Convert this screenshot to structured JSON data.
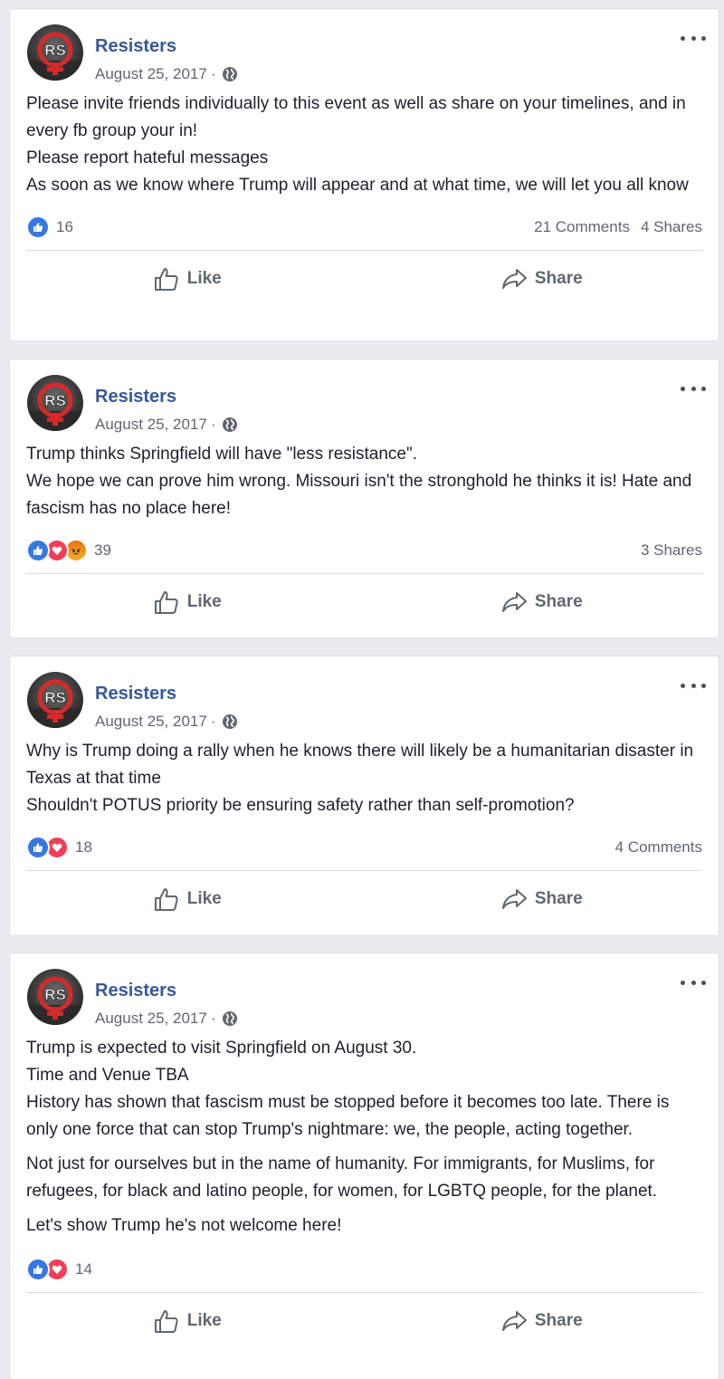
{
  "posts": [
    {
      "page_name": "Resisters",
      "date": "August 25, 2017",
      "paragraphs": [
        "Please invite friends individually to this event as well as share on your timelines, and in every fb group your in!",
        "Please report hateful messages",
        "As soon as we know where Trump will appear and at what time, we will let you all know"
      ],
      "reactions": [
        "like"
      ],
      "reaction_count": "16",
      "comments": "21 Comments",
      "shares": "4 Shares",
      "like_label": "Like",
      "share_label": "Share"
    },
    {
      "page_name": "Resisters",
      "date": "August 25, 2017",
      "paragraphs": [
        "Trump thinks Springfield will have \"less resistance\".",
        "We hope we can prove him wrong. Missouri isn't the stronghold he thinks it is! Hate and fascism has no place here!"
      ],
      "reactions": [
        "like",
        "love",
        "angry"
      ],
      "reaction_count": "39",
      "comments": "",
      "shares": "3 Shares",
      "like_label": "Like",
      "share_label": "Share"
    },
    {
      "page_name": "Resisters",
      "date": "August 25, 2017",
      "paragraphs": [
        "Why is Trump doing a rally when he knows there will likely be a humanitarian disaster in Texas at that time",
        "Shouldn't POTUS priority be ensuring safety rather than self-promotion?"
      ],
      "reactions": [
        "like",
        "love"
      ],
      "reaction_count": "18",
      "comments": "4 Comments",
      "shares": "",
      "like_label": "Like",
      "share_label": "Share"
    },
    {
      "page_name": "Resisters",
      "date": "August 25, 2017",
      "paragraphs": [
        "Trump is expected to visit Springfield on August 30.",
        "Time and Venue TBA",
        "History has shown that fascism must be stopped before it becomes too late. There is only one force that can stop Trump's nightmare: we, the people, acting together.",
        "Not just for ourselves but in the name of humanity. For immigrants, for Muslims, for refugees, for black and latino people, for women, for LGBTQ people, for the planet.",
        "Let's show Trump he's not welcome here!"
      ],
      "reactions": [
        "like",
        "love"
      ],
      "reaction_count": "14",
      "comments": "",
      "shares": "",
      "like_label": "Like",
      "share_label": "Share"
    }
  ],
  "avatar_text": "RS",
  "colors": {
    "page_name": "#365899",
    "like": "#3578e5",
    "love": "#f33e58",
    "angry": "#f7b125",
    "avatar_red": "#d42a2a"
  },
  "icons": {
    "privacy": "globe-icon",
    "menu": "more-options-icon",
    "like_action": "thumbs-up-icon",
    "share_action": "share-arrow-icon"
  }
}
